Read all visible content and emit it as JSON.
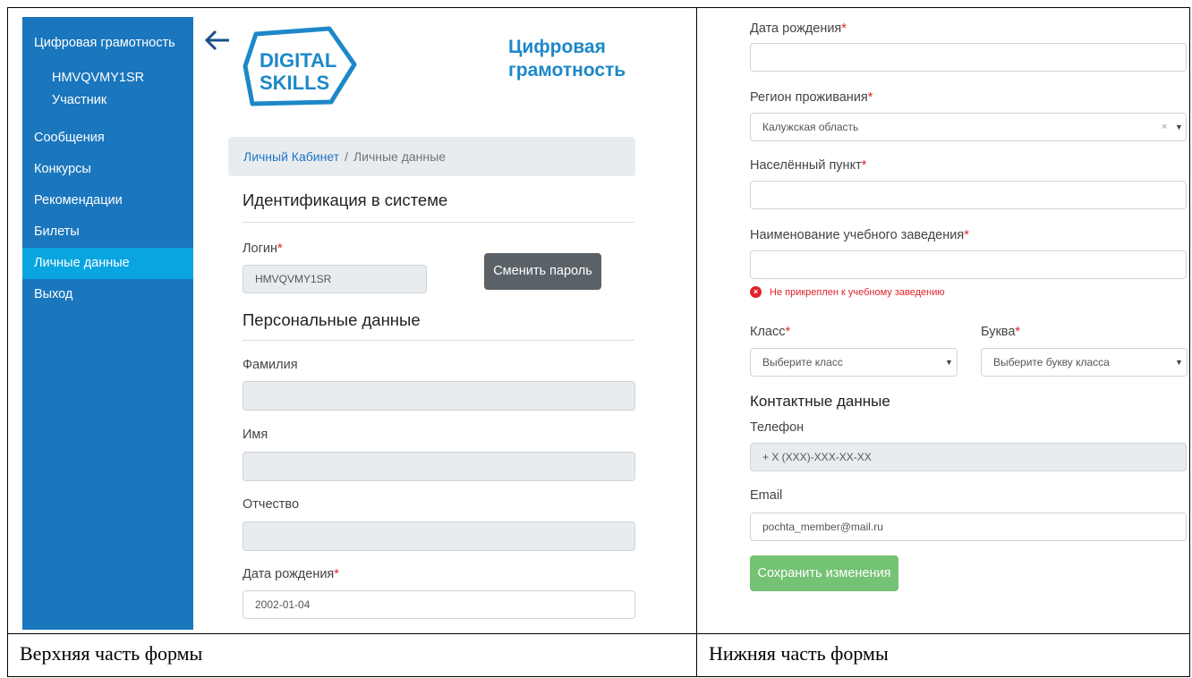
{
  "sidebar": {
    "brand": "Цифровая грамотность",
    "login": "HMVQVMY1SR",
    "role": "Участник",
    "items": [
      {
        "label": "Сообщения"
      },
      {
        "label": "Конкурсы"
      },
      {
        "label": "Рекомендации"
      },
      {
        "label": "Билеты"
      },
      {
        "label": "Личные данные"
      },
      {
        "label": "Выход"
      }
    ]
  },
  "logo": {
    "line1": "DIGITAL",
    "line2": "SKILLS",
    "title_line1": "Цифровая",
    "title_line2": "грамотность"
  },
  "breadcrumb": {
    "link": "Личный Кабинет",
    "separator": "/",
    "current": "Личные данные"
  },
  "identification": {
    "title": "Идентификация в системе",
    "login_label": "Логин",
    "login_value": "HMVQVMY1SR",
    "change_password": "Сменить пароль"
  },
  "personal": {
    "title": "Персональные данные",
    "surname_label": "Фамилия",
    "surname_value": "",
    "name_label": "Имя",
    "name_value": "",
    "patronymic_label": "Отчество",
    "patronymic_value": "",
    "birthdate_label": "Дата рождения",
    "birthdate_value": "2002-01-04"
  },
  "lower_form": {
    "birthdate_label": "Дата рождения",
    "birthdate_value": "",
    "region_label": "Регион проживания",
    "region_value": "Калужская область",
    "locality_label": "Населённый пункт",
    "locality_value": "",
    "school_label": "Наименование учебного заведения",
    "school_value": "",
    "school_error": "Не прикреплен к учебному заведению",
    "class_label": "Класс",
    "class_placeholder": "Выберите класс",
    "letter_label": "Буква",
    "letter_placeholder": "Выберите букву класса"
  },
  "contacts": {
    "title": "Контактные данные",
    "phone_label": "Телефон",
    "phone_placeholder": "+ X (XXX)-XXX-XX-XX",
    "email_label": "Email",
    "email_value": "pochta_member@mail.ru",
    "save_button": "Сохранить изменения"
  },
  "captions": {
    "left": "Верхняя часть формы",
    "right": "Нижняя часть формы"
  },
  "colors": {
    "sidebar": "#1a76bd",
    "sidebar_active": "#08a5e0",
    "brand_blue": "#1d88c8",
    "required": "#e0222b",
    "save_green": "#5cb85c",
    "button_gray": "#5a6268"
  },
  "icons": {
    "back": "arrow-left-icon",
    "error": "error-circle-icon",
    "caret": "caret-down-icon",
    "clear": "clear-x-icon"
  }
}
